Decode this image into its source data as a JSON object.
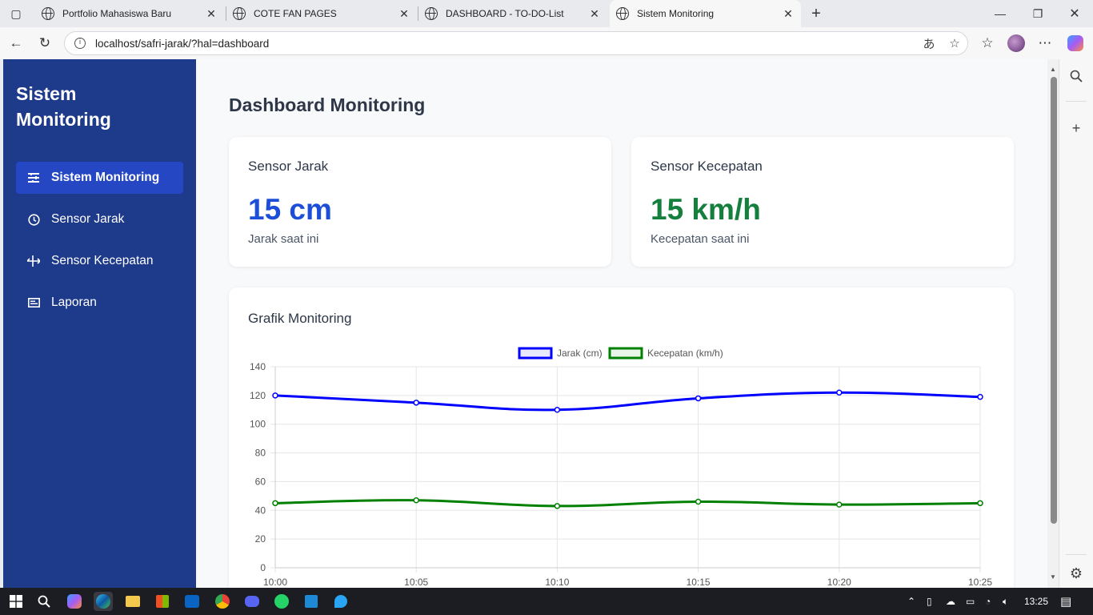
{
  "browser": {
    "tabs": [
      {
        "title": "Portfolio Mahasiswa Baru",
        "active": false
      },
      {
        "title": "COTE FAN PAGES",
        "active": false
      },
      {
        "title": "DASHBOARD - TO-DO-List",
        "active": false
      },
      {
        "title": "Sistem Monitoring",
        "active": true
      }
    ],
    "url": "localhost/safri-jarak/?hal=dashboard"
  },
  "sidebar": {
    "brand": "Sistem Monitoring",
    "items": [
      {
        "label": "Sistem Monitoring",
        "icon": "sliders-icon",
        "active": true
      },
      {
        "label": "Sensor Jarak",
        "icon": "clock-icon",
        "active": false
      },
      {
        "label": "Sensor Kecepatan",
        "icon": "arrows-icon",
        "active": false
      },
      {
        "label": "Laporan",
        "icon": "report-icon",
        "active": false
      }
    ]
  },
  "main": {
    "title": "Dashboard Monitoring",
    "cards": [
      {
        "title": "Sensor Jarak",
        "value": "15 cm",
        "caption": "Jarak saat ini",
        "color": "#1d4ed8"
      },
      {
        "title": "Sensor Kecepatan",
        "value": "15 km/h",
        "caption": "Kecepatan saat ini",
        "color": "#15803d"
      }
    ],
    "chart_title": "Grafik Monitoring"
  },
  "chart_data": {
    "type": "line",
    "x": [
      "10:00",
      "10:05",
      "10:10",
      "10:15",
      "10:20",
      "10:25"
    ],
    "series": [
      {
        "name": "Jarak (cm)",
        "color": "#0000ff",
        "values": [
          120,
          115,
          110,
          118,
          122,
          119
        ]
      },
      {
        "name": "Kecepatan (km/h)",
        "color": "#008000",
        "values": [
          45,
          47,
          43,
          46,
          44,
          45
        ]
      }
    ],
    "ylim": [
      0,
      140
    ],
    "yticks": [
      0,
      20,
      40,
      60,
      80,
      100,
      120,
      140
    ],
    "grid": true,
    "legend": "top-center"
  },
  "taskbar": {
    "time": "13:25"
  }
}
